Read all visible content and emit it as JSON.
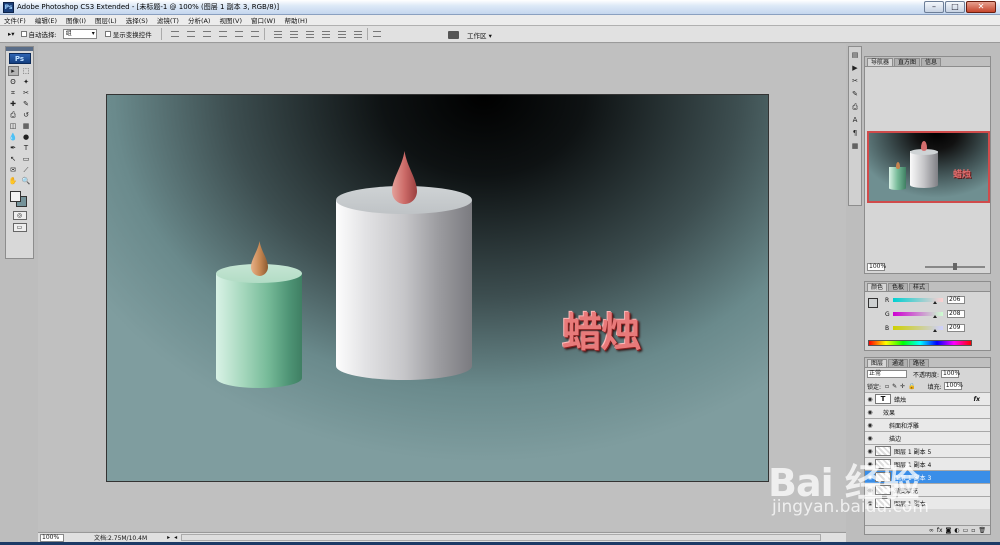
{
  "window": {
    "app_badge": "Ps",
    "title": "Adobe Photoshop CS3 Extended - [未标题-1 @ 100% (图层 1 副本 3, RGB/8)]",
    "min": "–",
    "max": "□",
    "close": "✕"
  },
  "menu": [
    "文件(F)",
    "编辑(E)",
    "图像(I)",
    "图层(L)",
    "选择(S)",
    "滤镜(T)",
    "分析(A)",
    "视图(V)",
    "窗口(W)",
    "帮助(H)"
  ],
  "options": {
    "auto_select_label": "自动选择:",
    "auto_select_value": "组",
    "show_transform": "显示变换控件",
    "workspace": "工作区 ▾"
  },
  "toolbox": {
    "logo": "Ps",
    "tools": [
      "move-tool",
      "marquee-tool",
      "lasso-tool",
      "magic-wand-tool",
      "crop-tool",
      "slice-tool",
      "healing-tool",
      "brush-tool",
      "stamp-tool",
      "history-brush-tool",
      "eraser-tool",
      "gradient-tool",
      "blur-tool",
      "dodge-tool",
      "pen-tool",
      "type-tool",
      "path-select-tool",
      "shape-tool",
      "notes-tool",
      "eyedropper-tool",
      "hand-tool",
      "zoom-tool"
    ],
    "glyphs": [
      "▸",
      "⬚",
      "ʘ",
      "✦",
      "⌗",
      "✂",
      "✚",
      "✎",
      "⎙",
      "↺",
      "◫",
      "▦",
      "💧",
      "●",
      "✒",
      "T",
      "↖",
      "▭",
      "✉",
      "⟋",
      "✋",
      "🔍"
    ]
  },
  "canvas": {
    "text": "蜡烛",
    "colors": {
      "background_dark": "#000000",
      "background_light": "#7f9d9f",
      "big_candle": "#c6c6c9",
      "small_candle": "#77bb99",
      "text": "#e87a7a"
    }
  },
  "status": {
    "zoom": "100%",
    "doc": "文档:2.75M/10.4M"
  },
  "navigator": {
    "tabs": [
      "导航器",
      "直方图",
      "信息"
    ],
    "zoom": "100%",
    "thumb_text": "蜡烛"
  },
  "color": {
    "tabs": [
      "颜色",
      "色板",
      "样式"
    ],
    "rows": [
      {
        "label": "R",
        "value": "206",
        "gradient": "linear-gradient(90deg,#00d0d1,#ffd0d1)"
      },
      {
        "label": "G",
        "value": "208",
        "gradient": "linear-gradient(90deg,#ce00d1,#ceffd1)"
      },
      {
        "label": "B",
        "value": "209",
        "gradient": "linear-gradient(90deg,#ced000,#ced0ff)"
      }
    ]
  },
  "layers": {
    "tabs": [
      "图层",
      "通道",
      "路径"
    ],
    "blend_mode": "正常",
    "opacity_label": "不透明度:",
    "opacity": "100%",
    "lock_label": "锁定:",
    "fill_label": "填充:",
    "fill": "100%",
    "items": [
      {
        "name": "蜡烛",
        "type": "text",
        "fx": "fx",
        "active": false
      },
      {
        "name": "效果",
        "type": "effect-group",
        "active": false
      },
      {
        "name": "斜面和浮雕",
        "type": "effect",
        "active": false
      },
      {
        "name": "描边",
        "type": "effect",
        "active": false
      },
      {
        "name": "图层 1 副本 5",
        "type": "layer",
        "active": false
      },
      {
        "name": "图层 1 副本 4",
        "type": "layer",
        "active": false
      },
      {
        "name": "图层 1 副本 3",
        "type": "layer",
        "active": true
      },
      {
        "name": "渐变填充",
        "type": "layer",
        "active": false
      },
      {
        "name": "图层 1 副本",
        "type": "layer",
        "active": false
      }
    ],
    "footer_icons": [
      "link-icon",
      "fx-icon",
      "mask-icon",
      "adjustment-icon",
      "folder-icon",
      "new-layer-icon",
      "trash-icon"
    ],
    "footer_glyphs": [
      "∞",
      "fx",
      "◙",
      "◐",
      "▭",
      "▫",
      "🗑"
    ]
  },
  "watermark": {
    "brand": "Bai 经验",
    "url": "jingyan.baidu.com"
  }
}
